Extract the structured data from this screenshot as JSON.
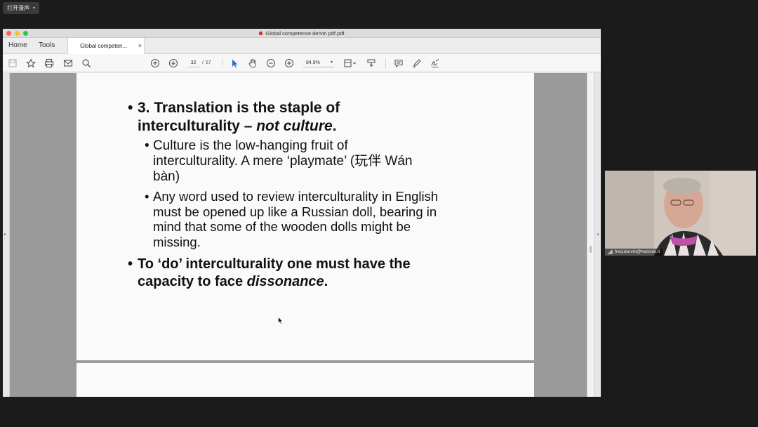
{
  "top_pill": {
    "label": "打开漫声"
  },
  "window": {
    "title": "Global competence dervin pdf.pdf"
  },
  "tabs": {
    "home": "Home",
    "tools": "Tools",
    "doc": "Global competen...",
    "close": "×"
  },
  "toolbar": {
    "page_current": "32",
    "page_separator": "/",
    "page_total": "57",
    "zoom": "84,9%",
    "icons": [
      "save-icon",
      "star-icon",
      "print-icon",
      "mail-icon",
      "search-icon",
      "prev-page-icon",
      "next-page-icon",
      "select-arrow-icon",
      "hand-icon",
      "zoom-out-icon",
      "zoom-in-icon",
      "fit-page-icon",
      "stamp-icon",
      "comment-icon",
      "highlight-pen-icon",
      "sign-icon"
    ]
  },
  "slide": {
    "bullet1_line1": "3. Translation is the staple of",
    "bullet1_line2_a": "interculturality – ",
    "bullet1_line2_em": "not culture",
    "bullet1_line2_b": ".",
    "sub1_line1": "Culture is the low-hanging fruit of",
    "sub1_line2": "interculturality. A mere ‘playmate’ (玩伴  Wán",
    "sub1_line3": "bàn)",
    "sub2_line1": "Any word used to review interculturality in English",
    "sub2_line2": "must be opened up like a Russian doll, bearing in",
    "sub2_line3": "mind that some of the wooden dolls might be",
    "sub2_line4": "missing.",
    "bullet2_line1": "To ‘do’ interculturality one must have the",
    "bullet2_line2_a": "capacity to face ",
    "bullet2_line2_em": "dissonance",
    "bullet2_line2_b": "."
  },
  "video": {
    "participant": "fred.dervin@helsinki.fi"
  },
  "colors": {
    "accent_blue": "#2a6fd6",
    "pdf_red": "#d7352b"
  }
}
